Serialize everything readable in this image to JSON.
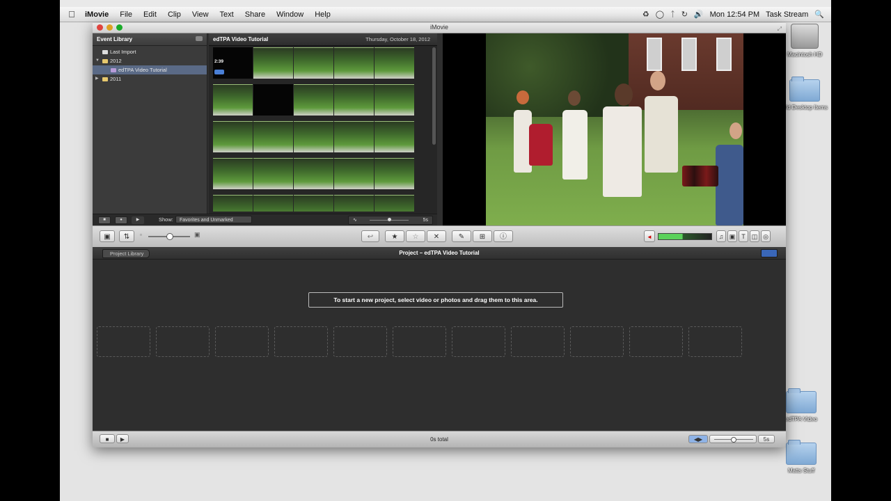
{
  "menubar": {
    "apple": "",
    "app": "iMovie",
    "items": [
      "File",
      "Edit",
      "Clip",
      "View",
      "Text",
      "Share",
      "Window",
      "Help"
    ],
    "clock": "Mon 12:54 PM",
    "task": "Task Stream"
  },
  "window": {
    "title": "iMovie"
  },
  "event_library": {
    "title": "Event Library",
    "items": [
      "Last Import",
      "2012",
      "edTPA Video Tutorial",
      "2011"
    ]
  },
  "browser": {
    "title": "edTPA Video Tutorial",
    "date": "Thursday, October 18, 2012",
    "duration": "2:39",
    "show_label": "Show:",
    "show_value": "Favorites and Unmarked",
    "zoom_value": "5s"
  },
  "project": {
    "library_button": "Project Library",
    "title": "Project – edTPA Video Tutorial",
    "hint": "To start a new project, select video or photos and drag them to this area.",
    "total": "0s total",
    "zoom_value": "5s"
  },
  "desktop": {
    "icons": [
      "Macintosh HD",
      "Old Desktop Items",
      "edTPA Video",
      "Matts Stuff"
    ]
  },
  "colors": {
    "window_bg": "#5c5c5c",
    "pane_dark": "#2e2e2e",
    "selection": "#5a6a86",
    "accent_blue": "#3a67b8"
  }
}
